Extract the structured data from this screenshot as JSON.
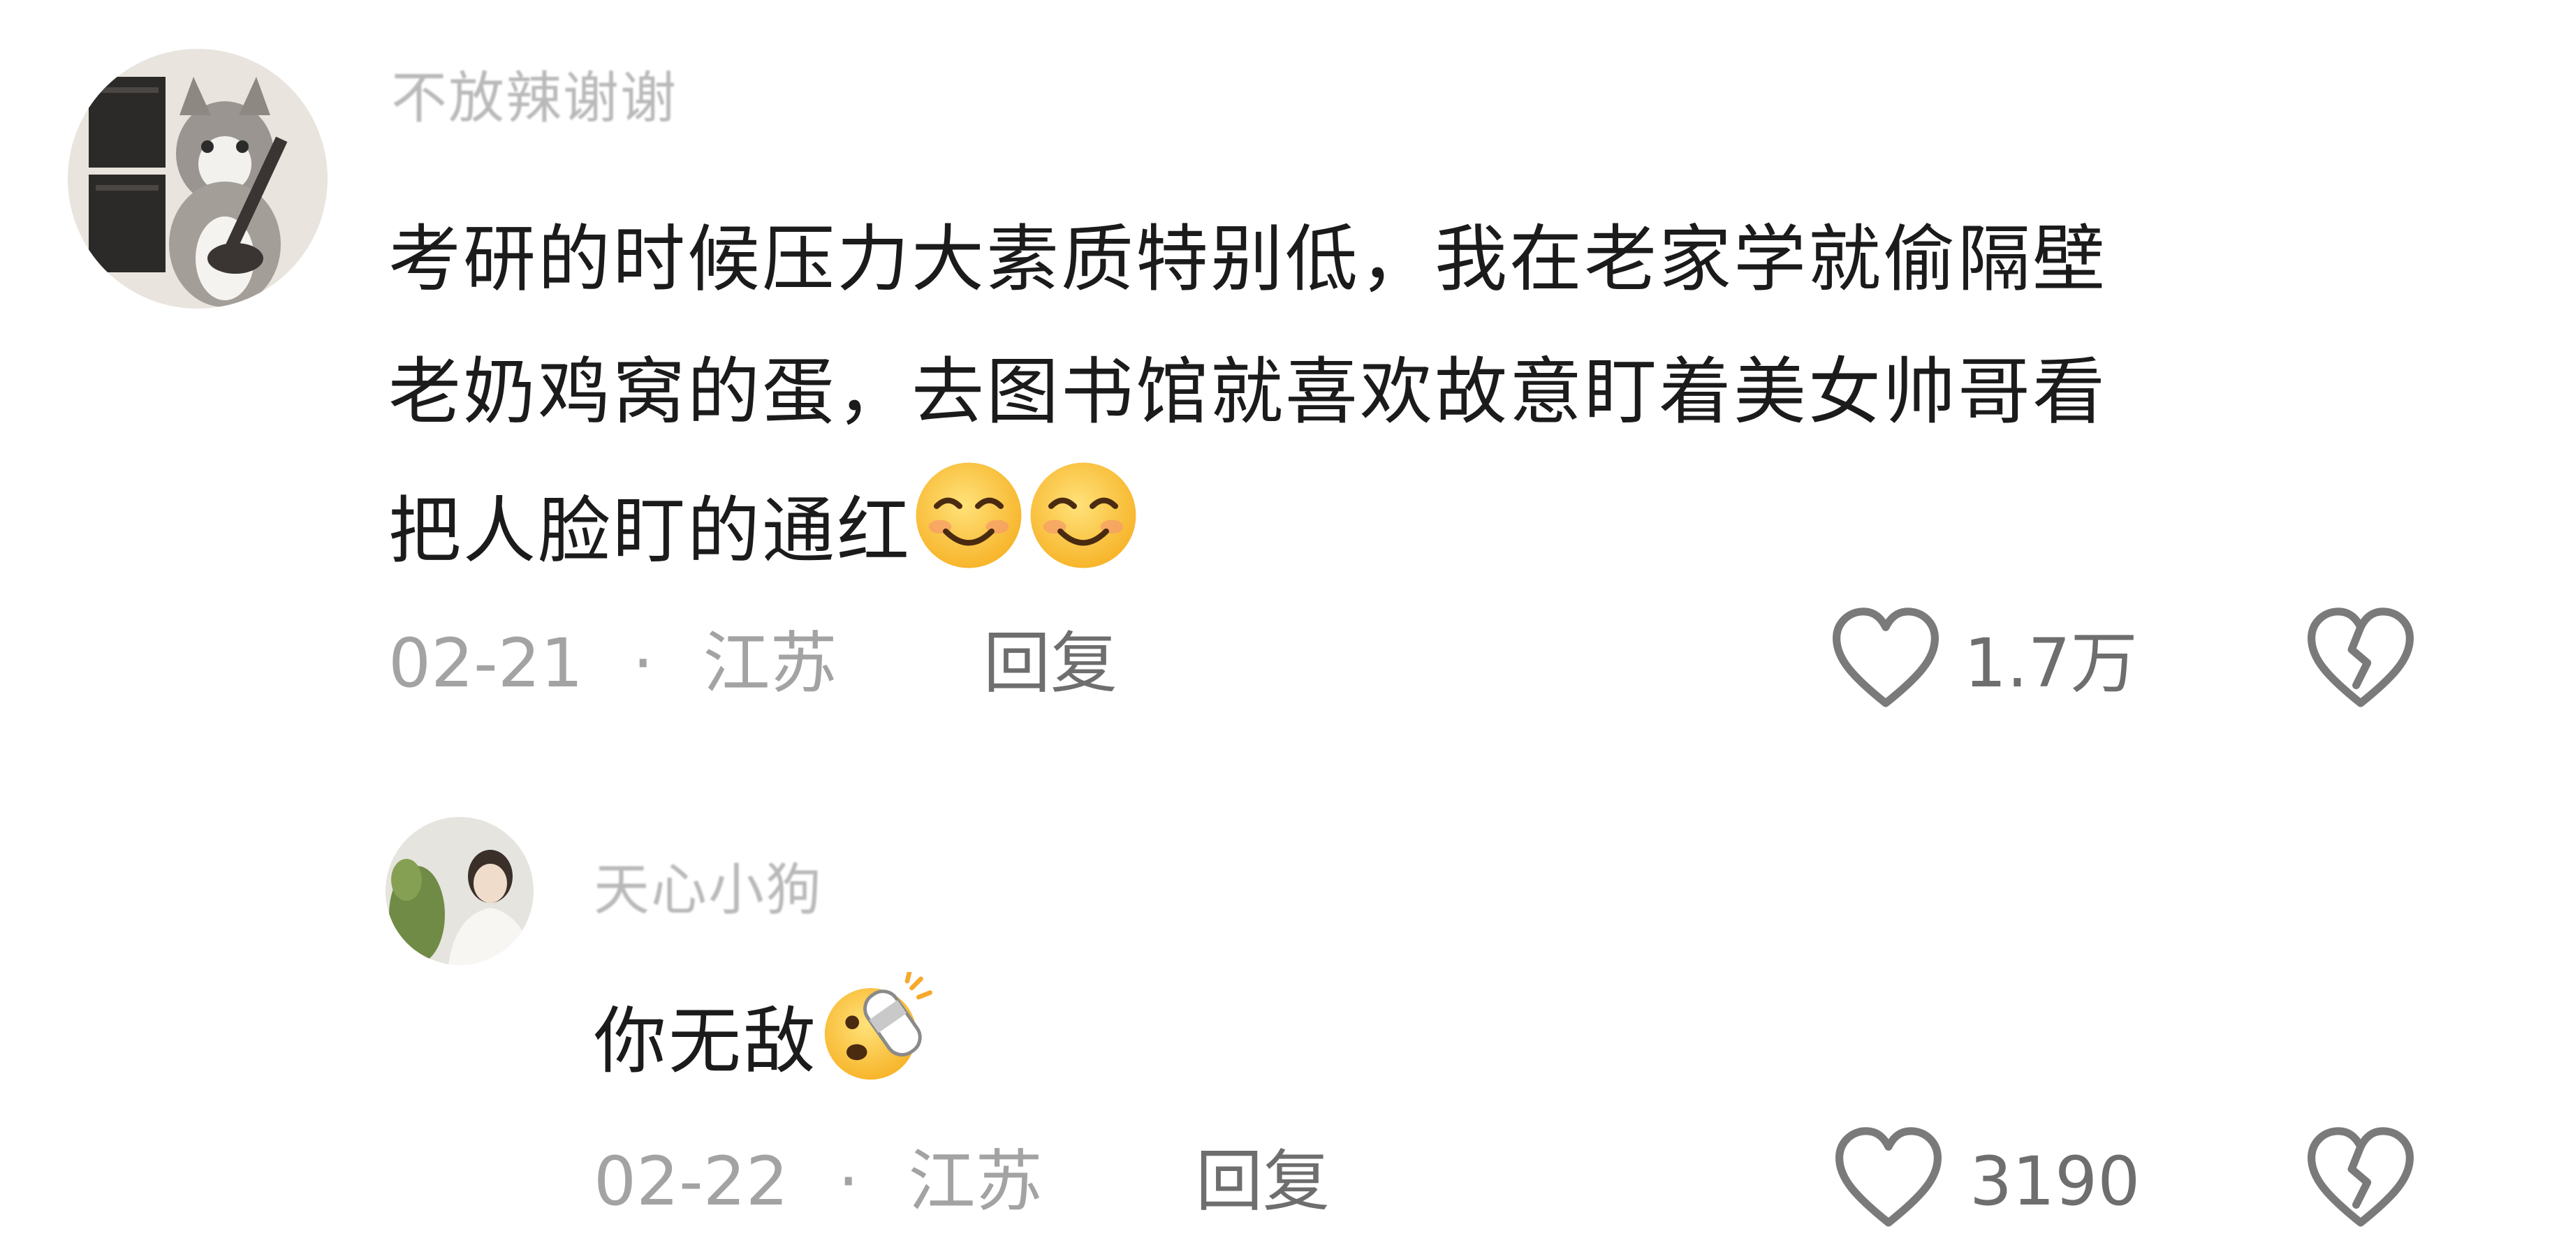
{
  "comments": [
    {
      "username": "不放辣谢谢",
      "content_lines": [
        "考研的时候压力大素质特别低，我在老家学就偷隔壁",
        "老奶鸡窝的蛋，去图书馆就喜欢故意盯着美女帅哥看",
        "把人脸盯的通红"
      ],
      "emoji": [
        "smiling-blush-emoji",
        "smiling-blush-emoji"
      ],
      "date": "02-21",
      "separator": "·",
      "location": "江苏",
      "reply_label": "回复",
      "like_count": "1.7万",
      "like_icon": "heart-outline-icon",
      "dislike_icon": "broken-heart-icon"
    },
    {
      "username": "天心小狗",
      "content": "你无敌",
      "emoji": [
        "slipper-slap-emoji"
      ],
      "date": "02-22",
      "separator": "·",
      "location": "江苏",
      "reply_label": "回复",
      "like_count": "3190",
      "like_icon": "heart-outline-icon",
      "dislike_icon": "broken-heart-icon"
    }
  ],
  "colors": {
    "username": "#b9b9b9",
    "content": "#1b1b1b",
    "meta": "#a3a3a3",
    "action": "#6e6e6e",
    "icon_stroke": "#7a7a7a",
    "emoji_face": "#ffc933"
  }
}
